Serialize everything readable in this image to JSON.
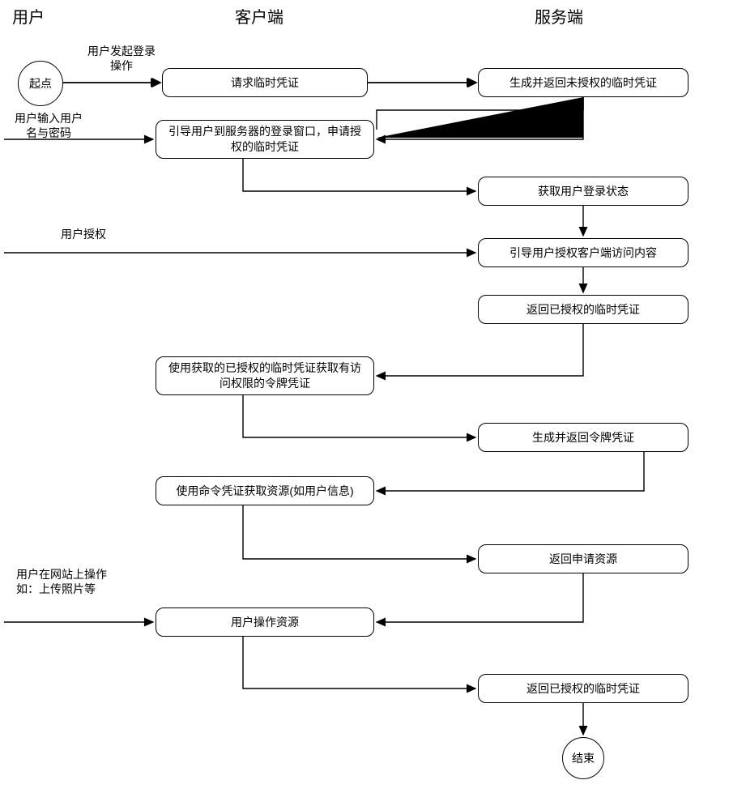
{
  "lanes": {
    "user": "用户",
    "client": "客户端",
    "server": "服务端"
  },
  "start": "起点",
  "end": "结束",
  "annot": {
    "login_action": "用户发起登录\n操作",
    "enter_creds": "用户输入用户\n名与密码",
    "authorize": "用户授权",
    "operate": "用户在网站上操作\n如：上传照片等"
  },
  "client": {
    "request_temp": "请求临时凭证",
    "guide_login": "引导用户到服务器的登录窗口，申请授权的临时凭证",
    "use_authorized_temp": "使用获取的已授权的临时凭证获取有访问权限的令牌凭证",
    "use_token_get_res": "使用命令凭证获取资源(如用户信息)",
    "user_op_resource": "用户操作资源"
  },
  "server": {
    "gen_unauth_temp": "生成并返回未授权的临时凭证",
    "get_login_status": "获取用户登录状态",
    "guide_authorize": "引导用户授权客户端访问内容",
    "return_authorized_temp": "返回已授权的临时凭证",
    "gen_return_token": "生成并返回令牌凭证",
    "return_resource": "返回申请资源",
    "return_authorized_temp2": "返回已授权的临时凭证"
  },
  "chart_data": {
    "type": "flowchart",
    "lanes": [
      "用户",
      "客户端",
      "服务端"
    ],
    "nodes": [
      {
        "id": "start",
        "lane": "用户",
        "label": "起点",
        "shape": "circle"
      },
      {
        "id": "c1",
        "lane": "客户端",
        "label": "请求临时凭证"
      },
      {
        "id": "s1",
        "lane": "服务端",
        "label": "生成并返回未授权的临时凭证"
      },
      {
        "id": "c2",
        "lane": "客户端",
        "label": "引导用户到服务器的登录窗口，申请授权的临时凭证"
      },
      {
        "id": "s2",
        "lane": "服务端",
        "label": "获取用户登录状态"
      },
      {
        "id": "s3",
        "lane": "服务端",
        "label": "引导用户授权客户端访问内容"
      },
      {
        "id": "s4",
        "lane": "服务端",
        "label": "返回已授权的临时凭证"
      },
      {
        "id": "c3",
        "lane": "客户端",
        "label": "使用获取的已授权的临时凭证获取有访问权限的令牌凭证"
      },
      {
        "id": "s5",
        "lane": "服务端",
        "label": "生成并返回令牌凭证"
      },
      {
        "id": "c4",
        "lane": "客户端",
        "label": "使用命令凭证获取资源(如用户信息)"
      },
      {
        "id": "s6",
        "lane": "服务端",
        "label": "返回申请资源"
      },
      {
        "id": "c5",
        "lane": "客户端",
        "label": "用户操作资源"
      },
      {
        "id": "s7",
        "lane": "服务端",
        "label": "返回已授权的临时凭证"
      },
      {
        "id": "end",
        "lane": "服务端",
        "label": "结束",
        "shape": "circle"
      }
    ],
    "edges": [
      {
        "from": "start",
        "to": "c1",
        "label": "用户发起登录操作"
      },
      {
        "from": "c1",
        "to": "s1"
      },
      {
        "from": "s1",
        "to": "c2"
      },
      {
        "from": "用户",
        "to": "c2",
        "label": "用户输入用户名与密码"
      },
      {
        "from": "c2",
        "to": "s2"
      },
      {
        "from": "s2",
        "to": "s3"
      },
      {
        "from": "用户",
        "to": "s3",
        "label": "用户授权"
      },
      {
        "from": "s3",
        "to": "s4"
      },
      {
        "from": "s4",
        "to": "c3"
      },
      {
        "from": "c3",
        "to": "s5"
      },
      {
        "from": "s5",
        "to": "c4"
      },
      {
        "from": "c4",
        "to": "s6"
      },
      {
        "from": "用户",
        "to": "c5",
        "label": "用户在网站上操作 如：上传照片等"
      },
      {
        "from": "s6",
        "to": "c5"
      },
      {
        "from": "c5",
        "to": "s7"
      },
      {
        "from": "s7",
        "to": "end"
      }
    ]
  }
}
